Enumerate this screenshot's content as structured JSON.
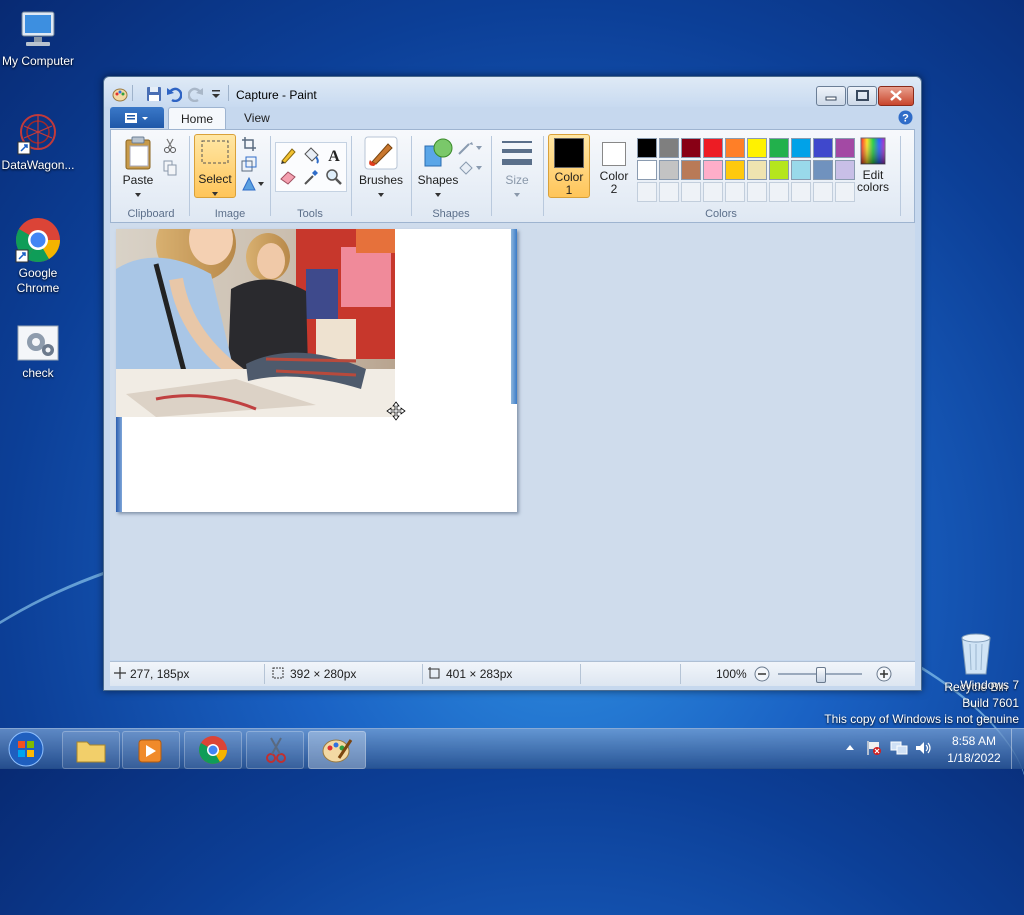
{
  "desktop": {
    "icons": [
      {
        "label": "My Computer"
      },
      {
        "label": "DataWagon..."
      },
      {
        "label": "Google Chrome"
      },
      {
        "label": "check"
      },
      {
        "label": "Recycle Bin"
      }
    ],
    "watermark": {
      "line1": "Windows 7",
      "line2": "Build 7601",
      "line3": "This copy of Windows is not genuine"
    }
  },
  "window": {
    "title": "Capture - Paint",
    "tabs": {
      "home": "Home",
      "view": "View"
    },
    "ribbon": {
      "clipboard": {
        "paste": "Paste",
        "group": "Clipboard"
      },
      "image": {
        "select": "Select",
        "group": "Image"
      },
      "tools": {
        "group": "Tools"
      },
      "brushes": {
        "label": "Brushes"
      },
      "shapes": {
        "label": "Shapes",
        "group": "Shapes"
      },
      "size": {
        "label": "Size"
      },
      "colors": {
        "color1": "Color 1",
        "color1_line1": "Color",
        "color1_line2": "1",
        "color2_line1": "Color",
        "color2_line2": "2",
        "edit_line1": "Edit",
        "edit_line2": "colors",
        "group": "Colors",
        "palette_row1": [
          "#000000",
          "#7f7f7f",
          "#880015",
          "#ed1c24",
          "#ff7f27",
          "#fff200",
          "#22b14c",
          "#00a2e8",
          "#3f48cc",
          "#a349a4"
        ],
        "palette_row2": [
          "#ffffff",
          "#c3c3c3",
          "#b97a57",
          "#ffaec9",
          "#ffc90e",
          "#efe4b0",
          "#b5e61d",
          "#99d9ea",
          "#7092be",
          "#c8bfe7"
        ],
        "selected_color1": "#000000",
        "selected_color2": "#ffffff"
      }
    },
    "status": {
      "cursor_pos": "277, 185px",
      "selection_size": "392 × 280px",
      "image_size": "401 × 283px",
      "zoom": "100%"
    }
  },
  "taskbar": {
    "time": "8:58 AM",
    "date": "1/18/2022"
  }
}
